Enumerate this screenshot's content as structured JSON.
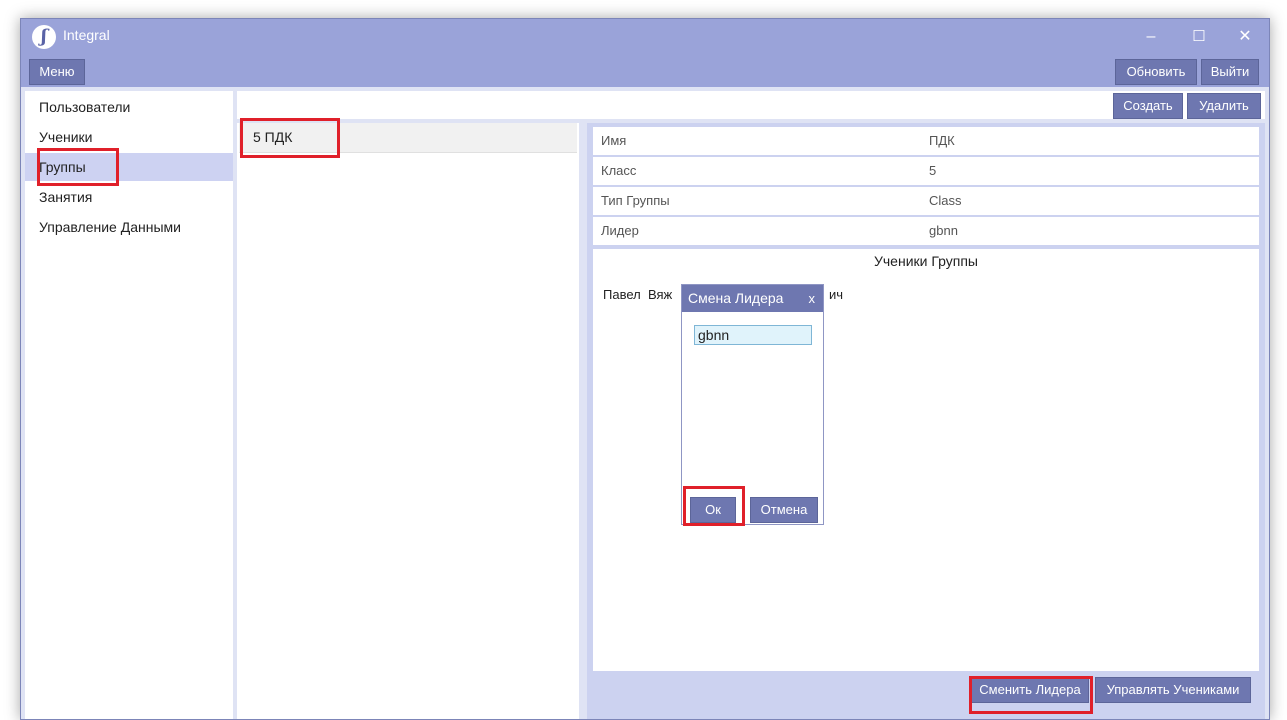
{
  "app": {
    "title": "Integral",
    "logo_glyph": "ʃ"
  },
  "window_controls": {
    "minimize": "–",
    "maximize": "☐",
    "close": "✕"
  },
  "menubar": {
    "menu_label": "Меню",
    "refresh_label": "Обновить",
    "exit_label": "Выйти"
  },
  "sidebar": {
    "items": [
      {
        "label": "Пользователи"
      },
      {
        "label": "Ученики"
      },
      {
        "label": "Группы",
        "active": true
      },
      {
        "label": "Занятия"
      },
      {
        "label": "Управление Данными"
      }
    ]
  },
  "toolbar": {
    "create_label": "Создать",
    "delete_label": "Удалить"
  },
  "group_list": {
    "items": [
      {
        "label": "5  ПДК"
      }
    ]
  },
  "details": {
    "rows": [
      {
        "key": "Имя",
        "value": "ПДК"
      },
      {
        "key": "Класс",
        "value": "5"
      },
      {
        "key": "Тип Группы",
        "value": "Class"
      },
      {
        "key": "Лидер",
        "value": "gbnn"
      }
    ],
    "students_title": "Ученики Группы",
    "students_visible_left": "Павел  Вяж",
    "students_visible_right": "ич"
  },
  "bottom_buttons": {
    "change_leader": "Сменить Лидера",
    "manage_students": "Управлять Учениками"
  },
  "dialog": {
    "title": "Смена Лидера",
    "close_label": "x",
    "input_value": "gbnn",
    "ok_label": "Ок",
    "cancel_label": "Отмена"
  },
  "colors": {
    "titlebar": "#9aa3d9",
    "button": "#6e77b0",
    "active_nav": "#cdd2f2",
    "panel": "#ccd2f0",
    "highlight": "#e0202a"
  }
}
